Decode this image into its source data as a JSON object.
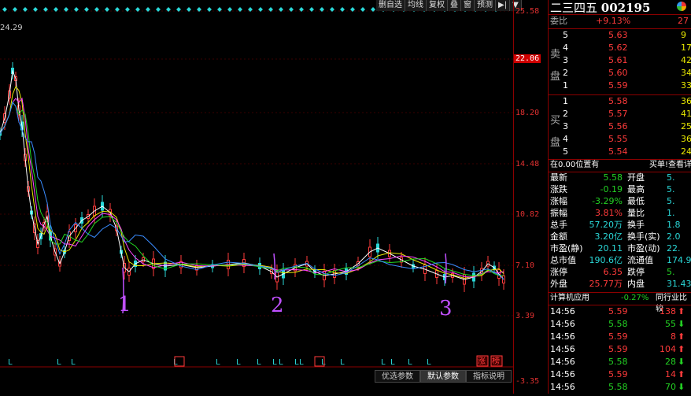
{
  "stock": {
    "name": "二三四五",
    "code": "002195"
  },
  "toolbar": [
    "删自选",
    "均线",
    "复权",
    "叠",
    "窗",
    "预测"
  ],
  "price_axis": [
    "25.58",
    "22.06",
    "18.20",
    "14.48",
    "10.82",
    "7.10",
    "3.39",
    "-3.35"
  ],
  "chart_top_label": "24.29",
  "handwritten_marks": [
    "1",
    "2",
    "3"
  ],
  "bottom_tabs": [
    "优选参数",
    "默认参数",
    "指标说明"
  ],
  "event_markers": [
    "L",
    "L",
    "L",
    "L",
    "L",
    "L",
    "L",
    "L",
    "L",
    "L",
    "L",
    "L",
    "L",
    "L",
    "L",
    "L",
    "L"
  ],
  "bottom_badges": [
    "涨",
    "榜"
  ],
  "weibi": {
    "label": "委比",
    "value": "+9.13%",
    "vol": "27"
  },
  "sell": [
    {
      "level": "5",
      "price": "5.63",
      "vol": "9"
    },
    {
      "level": "4",
      "price": "5.62",
      "vol": "17"
    },
    {
      "level": "3",
      "price": "5.61",
      "vol": "42"
    },
    {
      "level": "2",
      "price": "5.60",
      "vol": "34"
    },
    {
      "level": "1",
      "price": "5.59",
      "vol": "33"
    }
  ],
  "buy": [
    {
      "level": "1",
      "price": "5.58",
      "vol": "36"
    },
    {
      "level": "2",
      "price": "5.57",
      "vol": "41"
    },
    {
      "level": "3",
      "price": "5.56",
      "vol": "25"
    },
    {
      "level": "4",
      "price": "5.55",
      "vol": "36"
    },
    {
      "level": "5",
      "price": "5.54",
      "vol": "24"
    }
  ],
  "sell_label": [
    "卖",
    "盘"
  ],
  "buy_label": [
    "买",
    "盘"
  ],
  "position": {
    "left": "在0.00位置有",
    "right": "买单!查看详"
  },
  "quote": [
    {
      "l": "最新",
      "lv": "5.58",
      "r": "开盘",
      "rv": "5."
    },
    {
      "l": "涨跌",
      "lv": "-0.19",
      "r": "最高",
      "rv": "5."
    },
    {
      "l": "涨幅",
      "lv": "-3.29%",
      "r": "最低",
      "rv": "5."
    },
    {
      "l": "振幅",
      "lv": "3.81%",
      "r": "量比",
      "rv": "1."
    },
    {
      "l": "总手",
      "lv": "57.20万",
      "r": "换手",
      "rv": "1.8"
    },
    {
      "l": "金额",
      "lv": "3.20亿",
      "r": "换手(实)",
      "rv": "2.0"
    },
    {
      "l": "市盈(静)",
      "lv": "20.11",
      "r": "市盈(动)",
      "rv": "22."
    },
    {
      "l": "总市值",
      "lv": "190.6亿",
      "r": "流通值",
      "rv": "174.9"
    },
    {
      "l": "涨停",
      "lv": "6.35",
      "r": "跌停",
      "rv": "5."
    },
    {
      "l": "外盘",
      "lv": "25.77万",
      "r": "内盘",
      "rv": "31.43"
    }
  ],
  "sector": {
    "name": "计算机应用",
    "change": "-0.27%",
    "compare": "同行业比较"
  },
  "ticks": [
    {
      "time": "14:56",
      "price": "5.59",
      "vol": "138",
      "dir": "up"
    },
    {
      "time": "14:56",
      "price": "5.58",
      "vol": "55",
      "dir": "down"
    },
    {
      "time": "14:56",
      "price": "5.59",
      "vol": "8",
      "dir": "up"
    },
    {
      "time": "14:56",
      "price": "5.59",
      "vol": "104",
      "dir": "up"
    },
    {
      "time": "14:56",
      "price": "5.58",
      "vol": "28",
      "dir": "down"
    },
    {
      "time": "14:56",
      "price": "5.59",
      "vol": "14",
      "dir": "up"
    },
    {
      "time": "14:56",
      "price": "5.58",
      "vol": "70",
      "dir": "down"
    }
  ],
  "colors": {
    "up": "#ff3b3b",
    "down": "#23d123",
    "accent": "#d00000",
    "diamond": "#2ad8d8"
  }
}
